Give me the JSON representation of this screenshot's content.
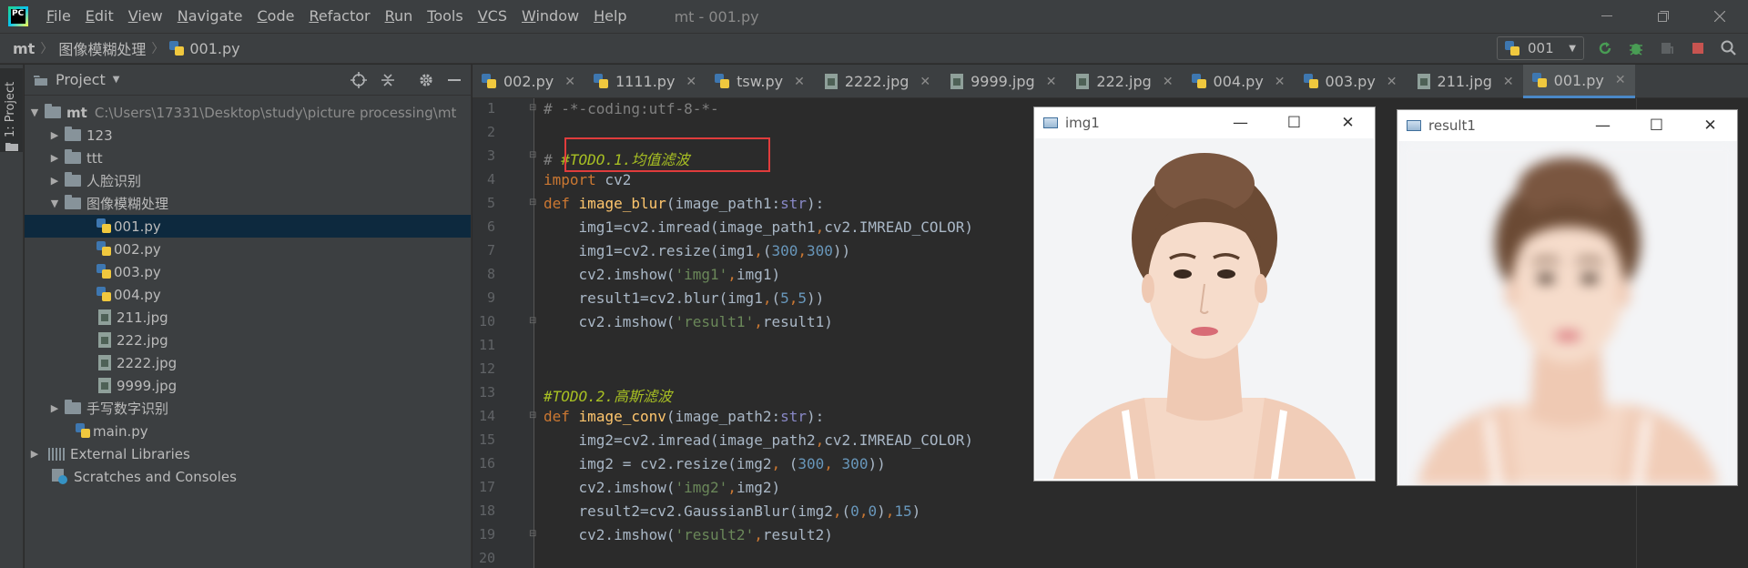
{
  "menubar": {
    "logo": "PC",
    "items": [
      {
        "label": "File",
        "ul": "F",
        "rest": "ile"
      },
      {
        "label": "Edit",
        "ul": "E",
        "rest": "dit"
      },
      {
        "label": "View",
        "ul": "V",
        "rest": "iew"
      },
      {
        "label": "Navigate",
        "ul": "N",
        "rest": "avigate"
      },
      {
        "label": "Code",
        "ul": "C",
        "rest": "ode"
      },
      {
        "label": "Refactor",
        "ul": "R",
        "rest": "efactor"
      },
      {
        "label": "Run",
        "ul": "R",
        "rest": "un"
      },
      {
        "label": "Tools",
        "ul": "T",
        "rest": "ools"
      },
      {
        "label": "VCS",
        "ul": "V",
        "rest": "CS"
      },
      {
        "label": "Window",
        "ul": "W",
        "rest": "indow"
      },
      {
        "label": "Help",
        "ul": "H",
        "rest": "elp"
      }
    ],
    "window_title": "mt - 001.py"
  },
  "navbar": {
    "crumbs": [
      "mt",
      "图像模糊处理",
      "001.py"
    ],
    "run_config": "001"
  },
  "side_stripe": {
    "label": "1: Project"
  },
  "project": {
    "title": "Project",
    "root_name": "mt",
    "root_path": "C:\\Users\\17331\\Desktop\\study\\picture processing\\mt",
    "folders_top": [
      "123",
      "ttt",
      "人脸识别"
    ],
    "open_folder": "图像模糊处理",
    "files": [
      "001.py",
      "002.py",
      "003.py",
      "004.py",
      "211.jpg",
      "222.jpg",
      "2222.jpg",
      "9999.jpg"
    ],
    "folder_bottom": "手写数字识别",
    "main_file": "main.py",
    "external": "External Libraries",
    "scratches": "Scratches and Consoles"
  },
  "tabs": [
    "002.py",
    "1111.py",
    "tsw.py",
    "2222.jpg",
    "9999.jpg",
    "222.jpg",
    "004.py",
    "003.py",
    "211.jpg",
    "001.py"
  ],
  "editor": {
    "line_numbers": [
      "1",
      "2",
      "3",
      "4",
      "5",
      "6",
      "7",
      "8",
      "9",
      "10",
      "11",
      "12",
      "13",
      "14",
      "15",
      "16",
      "17",
      "18",
      "19",
      "20"
    ]
  },
  "windows": {
    "img1_title": "img1",
    "result1_title": "result1"
  },
  "colors": {
    "accent": "#4a88c7",
    "highlight_box": "#e03c3c",
    "selection": "#0d293e"
  }
}
